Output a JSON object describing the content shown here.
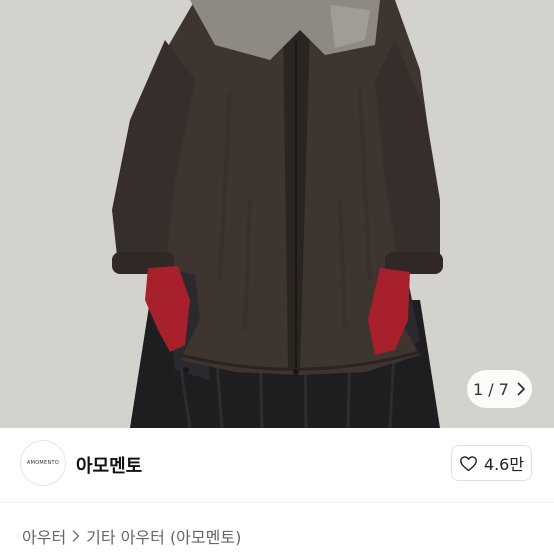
{
  "gallery": {
    "counter_text": "1 / 7",
    "icon": "chevron-right-icon"
  },
  "shop": {
    "logo_text": "AMOMENTO",
    "name": "아모멘토",
    "likes": "4.6만",
    "like_icon": "heart-outline-icon"
  },
  "breadcrumb": {
    "items": [
      "아우터",
      "기타 아우터 (아모멘토)"
    ],
    "separator_icon": "chevron-right-icon"
  },
  "colors": {
    "background": "#d4d2cd",
    "coat": "#3e3530",
    "fur": "#8e8983",
    "gloves": "#a8202b",
    "skirt": "#1e1d1f"
  }
}
